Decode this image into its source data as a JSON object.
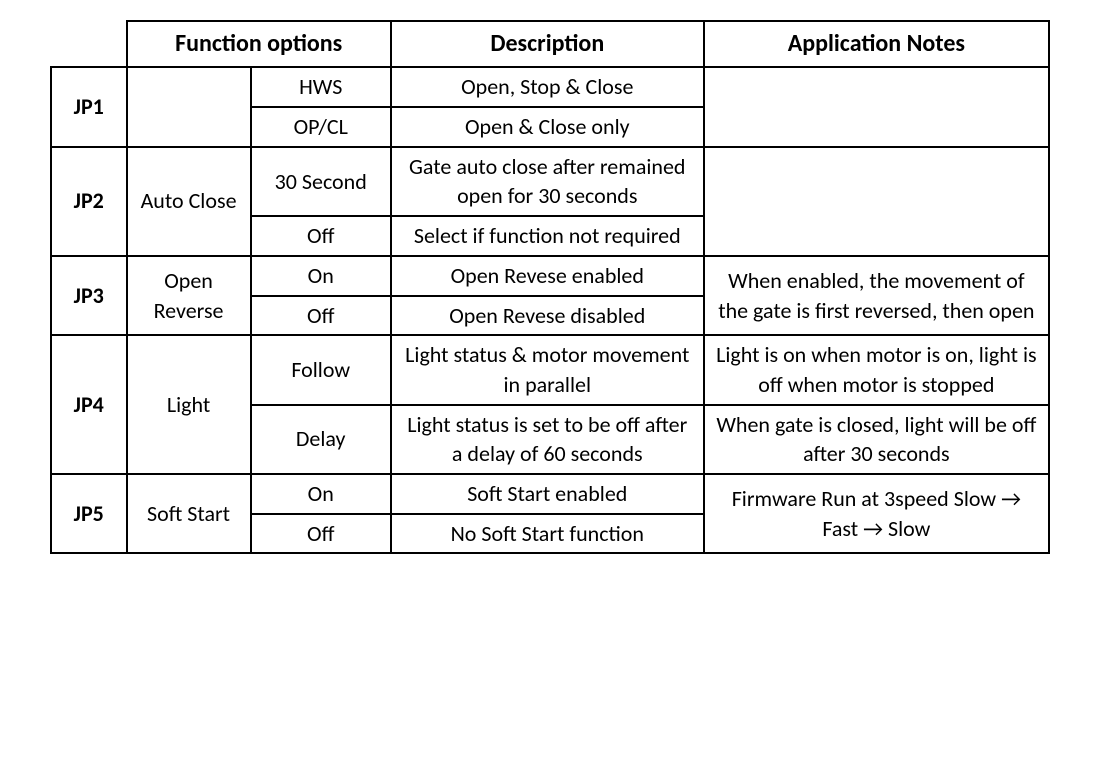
{
  "headers": {
    "function_options": "Function options",
    "description": "Description",
    "application_notes": "Application Notes"
  },
  "rows": {
    "jp1": {
      "label": "JP1",
      "func_name": "",
      "opts": [
        {
          "option": "HWS",
          "description": "Open, Stop & Close"
        },
        {
          "option": "OP/CL",
          "description": "Open & Close only"
        }
      ],
      "notes": ""
    },
    "jp2": {
      "label": "JP2",
      "func_name": "Auto Close",
      "opts": [
        {
          "option": "30 Second",
          "description": "Gate auto close after remained open for 30 seconds"
        },
        {
          "option": "Off",
          "description": "Select if function not required"
        }
      ],
      "notes": ""
    },
    "jp3": {
      "label": "JP3",
      "func_name": "Open Reverse",
      "opts": [
        {
          "option": "On",
          "description": "Open Revese enabled"
        },
        {
          "option": "Off",
          "description": "Open Revese disabled"
        }
      ],
      "notes": "When enabled, the movement of the gate is first reversed, then open"
    },
    "jp4": {
      "label": "JP4",
      "func_name": "Light",
      "opts": [
        {
          "option": "Follow",
          "description": "Light status & motor movement in parallel",
          "note": "Light is on when motor is on, light is off when motor is stopped"
        },
        {
          "option": "Delay",
          "description": "Light status is set to be off after a delay of 60 seconds",
          "note": "When gate is closed, light will be off after 30 seconds"
        }
      ]
    },
    "jp5": {
      "label": "JP5",
      "func_name": "Soft Start",
      "opts": [
        {
          "option": "On",
          "description": "Soft Start enabled"
        },
        {
          "option": "Off",
          "description": "No Soft Start function"
        }
      ],
      "notes": "Firmware Run at 3speed Slow → Fast → Slow"
    }
  }
}
